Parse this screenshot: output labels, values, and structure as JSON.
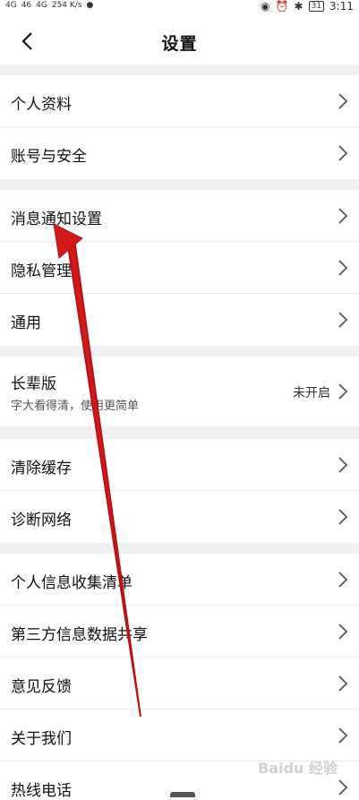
{
  "status_bar": {
    "left_text": [
      "4G",
      "46",
      "4G",
      "254 K/s"
    ],
    "time": "3:11",
    "battery": "31"
  },
  "header": {
    "title": "设置",
    "back_icon": "chevron-left-icon"
  },
  "groups": [
    {
      "items": [
        {
          "label": "个人资料"
        },
        {
          "label": "账号与安全"
        }
      ]
    },
    {
      "items": [
        {
          "label": "消息通知设置"
        },
        {
          "label": "隐私管理"
        },
        {
          "label": "通用"
        }
      ]
    },
    {
      "items": [
        {
          "label": "长辈版",
          "sub": "字大看得清，使用更简单",
          "status": "未开启"
        }
      ]
    },
    {
      "items": [
        {
          "label": "清除缓存"
        },
        {
          "label": "诊断网络"
        }
      ]
    },
    {
      "items": [
        {
          "label": "个人信息收集清单"
        },
        {
          "label": "第三方信息数据共享"
        },
        {
          "label": "意见反馈"
        },
        {
          "label": "关于我们"
        },
        {
          "label": "热线电话"
        }
      ]
    }
  ],
  "watermark": "Baidu 经验",
  "colors": {
    "arrow": "#d11a1a",
    "separator": "#f1f1f1"
  }
}
